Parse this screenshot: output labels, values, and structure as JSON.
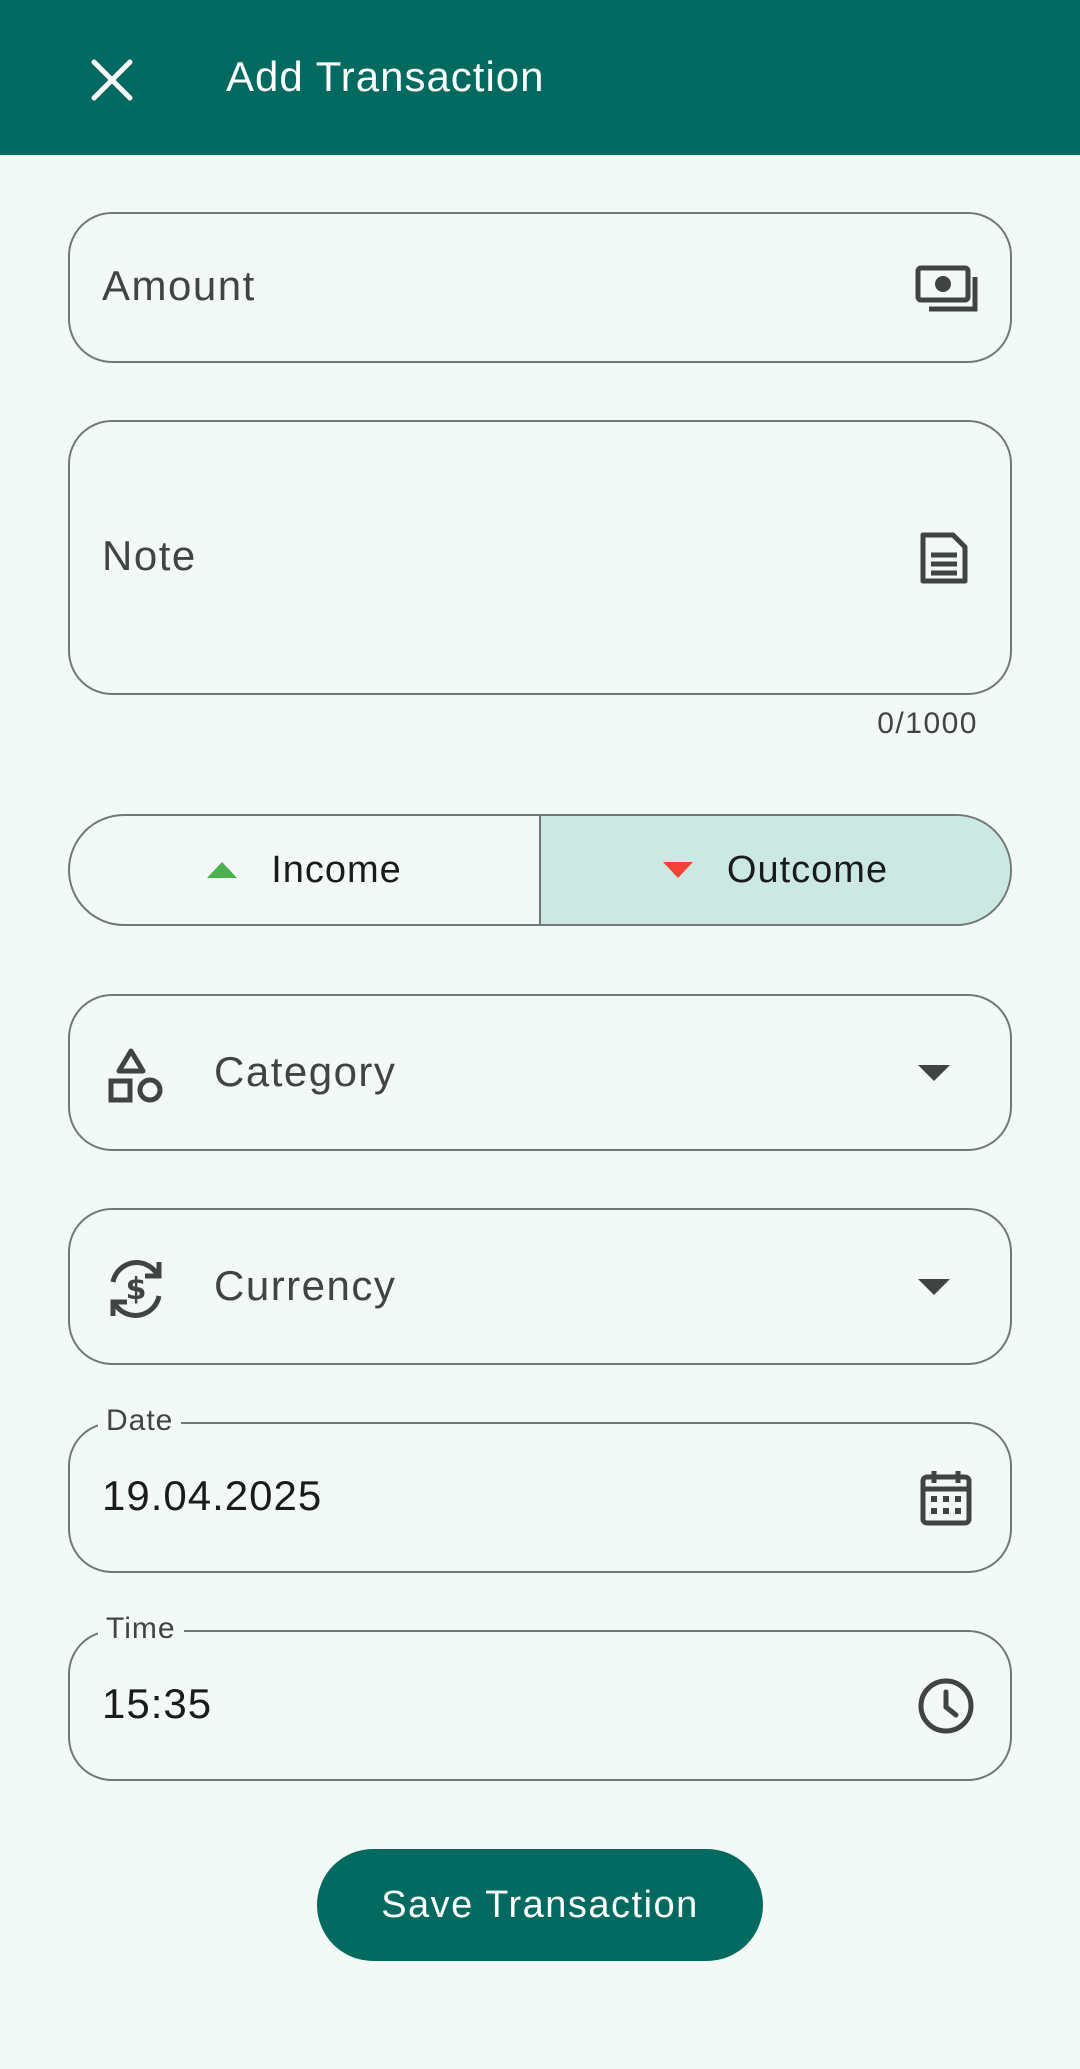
{
  "appbar": {
    "title": "Add Transaction",
    "close_icon": "close-icon",
    "background": "#006a60"
  },
  "form": {
    "amount": {
      "placeholder": "Amount",
      "icon": "payments-icon"
    },
    "note": {
      "placeholder": "Note",
      "icon": "notes-icon",
      "counter": "0/1000"
    },
    "type_toggle": {
      "options": [
        {
          "label": "Income",
          "icon": "arrow-up-icon",
          "color": "#4caf50",
          "selected": false
        },
        {
          "label": "Outcome",
          "icon": "arrow-down-icon",
          "color": "#f44336",
          "selected": true
        }
      ],
      "selected_background": "#cce8e2"
    },
    "category": {
      "placeholder": "Category",
      "icon": "category-icon"
    },
    "currency": {
      "placeholder": "Currency",
      "icon": "currency-exchange-icon"
    },
    "date": {
      "label": "Date",
      "value": "19.04.2025",
      "icon": "calendar-icon"
    },
    "time": {
      "label": "Time",
      "value": "15:35",
      "icon": "clock-icon"
    }
  },
  "actions": {
    "save_label": "Save Transaction"
  }
}
